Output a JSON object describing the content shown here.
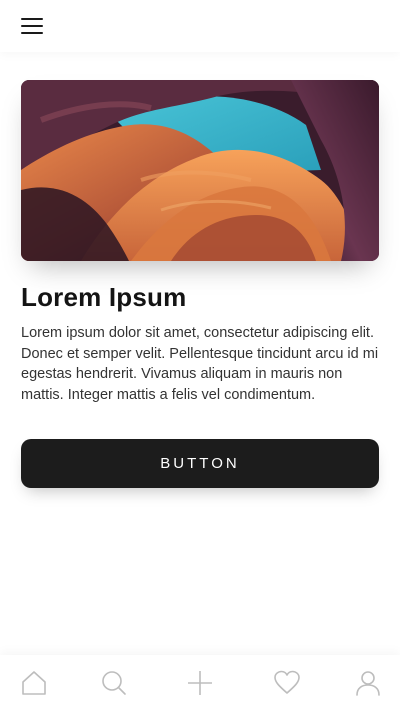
{
  "header": {
    "menu_icon": "hamburger-menu-icon"
  },
  "hero": {
    "image_subject": "canyon rock formation with sky opening"
  },
  "card": {
    "title": "Lorem Ipsum",
    "body": "Lorem ipsum dolor sit amet, consectetur adipiscing elit. Donec et semper velit. Pellentesque tincidunt arcu id mi egestas hendrerit. Vivamus aliquam in mauris non mattis. Integer mattis a felis vel condimentum.",
    "button_label": "BUTTON"
  },
  "tabbar": {
    "items": [
      {
        "icon": "home-icon"
      },
      {
        "icon": "search-icon"
      },
      {
        "icon": "plus-icon"
      },
      {
        "icon": "heart-icon"
      },
      {
        "icon": "user-icon"
      }
    ]
  },
  "colors": {
    "button_bg": "#1c1c1c",
    "button_text": "#ffffff",
    "icon_stroke": "#bdbdbd",
    "text_dark": "#141414"
  }
}
